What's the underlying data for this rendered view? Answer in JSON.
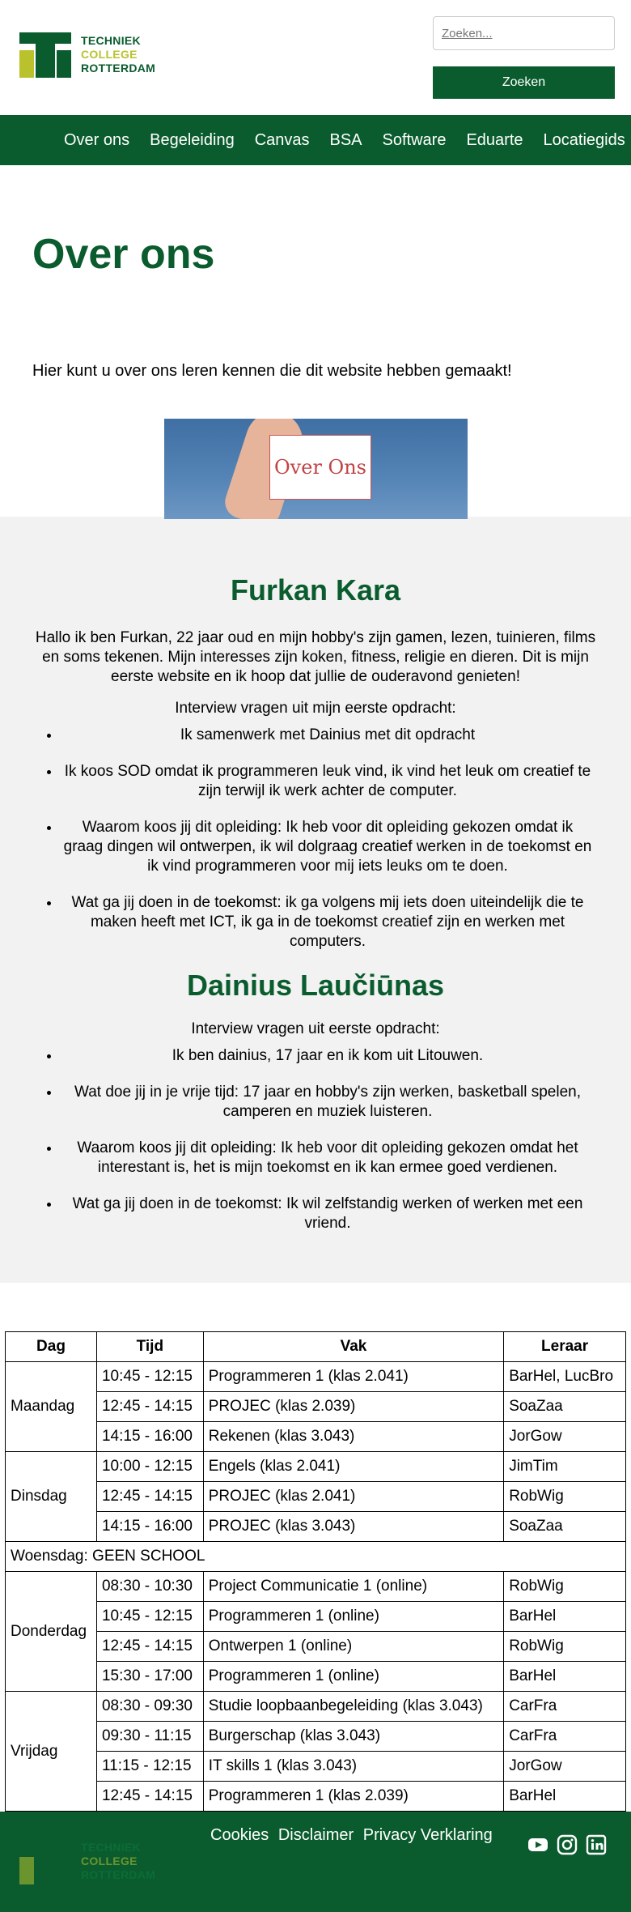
{
  "header": {
    "logo_lines": [
      "TECHNIEK",
      "COLLEGE",
      "ROTTERDAM"
    ],
    "search_placeholder": "Zoeken...",
    "search_button": "Zoeken"
  },
  "nav": {
    "items": [
      "Over ons",
      "Begeleiding",
      "Canvas",
      "BSA",
      "Software",
      "Eduarte",
      "Locatiegids"
    ]
  },
  "intro": {
    "title": "Over ons",
    "text": "Hier kunt u over ons leren kennen die dit website hebben gemaakt!",
    "image_text": "Over Ons"
  },
  "members": [
    {
      "name": "Furkan Kara",
      "bio": "Hallo ik ben Furkan, 22 jaar oud en mijn hobby's zijn gamen, lezen, tuinieren, films en soms tekenen. Mijn interesses zijn koken, fitness, religie en dieren. Dit is mijn eerste website en ik hoop dat jullie de ouderavond genieten!",
      "lead": "Interview vragen uit mijn eerste opdracht:",
      "answers": [
        "Ik samenwerk met Dainius met dit opdracht",
        "Ik koos SOD omdat ik programmeren leuk vind, ik vind het leuk om creatief te zijn terwijl ik werk achter de computer.",
        "Waarom koos jij dit opleiding: Ik heb voor dit opleiding gekozen omdat ik graag dingen wil ontwerpen, ik wil dolgraag creatief werken in de toekomst en ik vind programmeren voor mij iets leuks om te doen.",
        "Wat ga jij doen in de toekomst: ik ga volgens mij iets doen uiteindelijk die te maken heeft met ICT, ik ga in de toekomst creatief zijn en werken met computers."
      ]
    },
    {
      "name": "Dainius Laučiūnas",
      "lead": "Interview vragen uit eerste opdracht:",
      "answers": [
        "Ik ben dainius, 17 jaar en ik kom uit Litouwen.",
        "Wat doe jij in je vrije tijd: 17 jaar en hobby's zijn werken, basketball spelen, camperen en muziek luisteren.",
        "Waarom koos jij dit opleiding: Ik heb voor dit opleiding gekozen omdat het interestant is, het is mijn toekomst en ik kan ermee goed verdienen.",
        "Wat ga jij doen in de toekomst: Ik wil zelfstandig werken of werken met een vriend."
      ]
    }
  ],
  "schedule": {
    "headers": [
      "Dag",
      "Tijd",
      "Vak",
      "Leraar"
    ],
    "maandag": "Maandag",
    "dinsdag": "Dinsdag",
    "woensdag": "Woensdag: GEEN SCHOOL",
    "donderdag": "Donderdag",
    "vrijdag": "Vrijdag",
    "rows": [
      [
        "10:45 - 12:15",
        "Programmeren 1 (klas 2.041)",
        "BarHel, LucBro"
      ],
      [
        "12:45 - 14:15",
        "PROJEC (klas 2.039)",
        "SoaZaa"
      ],
      [
        "14:15 - 16:00",
        "Rekenen (klas 3.043)",
        "JorGow"
      ],
      [
        "10:00 - 12:15",
        "Engels (klas 2.041)",
        "JimTim"
      ],
      [
        "12:45 - 14:15",
        "PROJEC (klas 2.041)",
        "RobWig"
      ],
      [
        "14:15 - 16:00",
        "PROJEC (klas 3.043)",
        "SoaZaa"
      ],
      [
        "08:30 - 10:30",
        "Project Communicatie 1 (online)",
        "RobWig"
      ],
      [
        "10:45 - 12:15",
        "Programmeren 1 (online)",
        "BarHel"
      ],
      [
        "12:45 - 14:15",
        "Ontwerpen 1 (online)",
        "RobWig"
      ],
      [
        "15:30 - 17:00",
        "Programmeren 1 (online)",
        "BarHel"
      ],
      [
        "08:30 - 09:30",
        "Studie loopbaanbegeleiding (klas 3.043)",
        "CarFra"
      ],
      [
        "09:30 - 11:15",
        "Burgerschap (klas 3.043)",
        "CarFra"
      ],
      [
        "11:15 - 12:15",
        "IT skills 1 (klas 3.043)",
        "JorGow"
      ],
      [
        "12:45 - 14:15",
        "Programmeren 1 (klas 2.039)",
        "BarHel"
      ]
    ]
  },
  "footer": {
    "links": [
      "Cookies",
      "Disclaimer",
      "Privacy Verklaring"
    ],
    "social_icons": [
      "youtube-icon",
      "instagram-icon",
      "linkedin-icon"
    ]
  },
  "colors": {
    "brand_green": "#0a5c2e",
    "brand_yellow": "#b9c22d",
    "section_bg": "#f2f2f2"
  }
}
